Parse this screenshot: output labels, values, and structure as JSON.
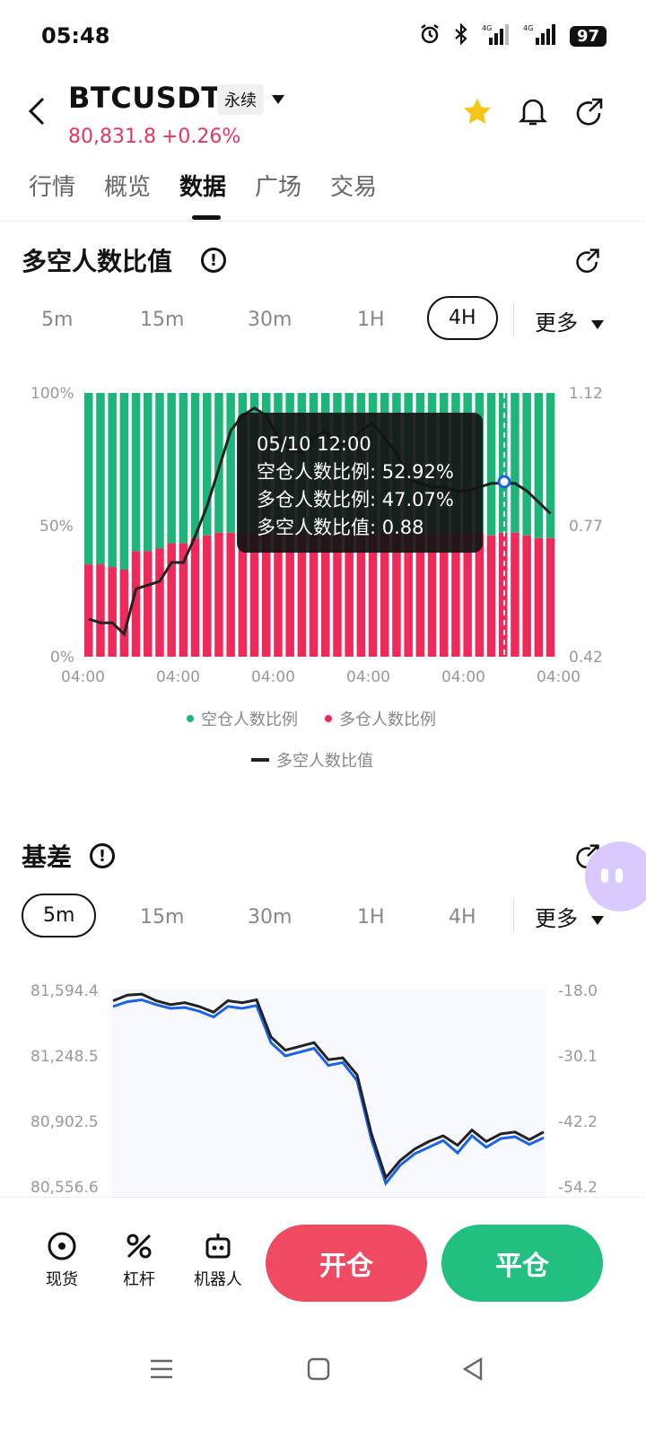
{
  "status": {
    "time": "05:48",
    "battery": "97"
  },
  "header": {
    "symbol": "BTCUSDT",
    "contract_tag": "永续",
    "price": "80,831.8",
    "change": "+0.26%"
  },
  "tabs": [
    "行情",
    "概览",
    "数据",
    "广场",
    "交易"
  ],
  "ratio_section": {
    "title": "多空人数比值",
    "timeframes": [
      "5m",
      "15m",
      "30m",
      "1H",
      "4H"
    ],
    "selected": "4H",
    "more_label": "更多",
    "tooltip": {
      "datetime": "05/10 12:00",
      "short_label": "空仓人数比例: 52.92%",
      "long_label": "多仓人数比例: 47.07%",
      "ratio_label": "多空人数比值: 0.88"
    },
    "legend": [
      "空仓人数比例",
      "多仓人数比例",
      "多空人数比值"
    ]
  },
  "basis_section": {
    "title": "基差",
    "timeframes": [
      "5m",
      "15m",
      "30m",
      "1H",
      "4H"
    ],
    "selected": "5m",
    "more_label": "更多"
  },
  "bottom": {
    "items": [
      "现货",
      "杠杆",
      "机器人"
    ],
    "open_label": "开仓",
    "close_label": "平仓"
  },
  "colors": {
    "green": "#1db57a",
    "red": "#ef2a5a",
    "accent_red": "#e7365d",
    "blue": "#1a63e6"
  },
  "chart_data": [
    {
      "type": "bar",
      "title": "多空人数比值",
      "x_ticks": [
        "04:00",
        "04:00",
        "04:00",
        "04:00",
        "04:00",
        "04:00"
      ],
      "y_left_ticks": [
        "100%",
        "50%",
        "0%"
      ],
      "y_right_ticks": [
        "1.12",
        "0.77",
        "0.42"
      ],
      "series": [
        {
          "name": "多仓人数比例",
          "values": [
            35,
            35,
            34,
            33,
            40,
            40,
            41,
            43,
            43,
            45,
            46,
            47,
            47,
            47,
            47,
            47,
            47,
            47,
            47,
            47,
            47,
            47,
            47,
            47,
            47,
            47,
            47,
            47,
            47,
            47,
            47,
            47,
            47,
            47,
            46,
            47,
            47,
            46,
            45,
            45
          ]
        },
        {
          "name": "多空人数比值",
          "values": [
            0.52,
            0.51,
            0.51,
            0.48,
            0.6,
            0.61,
            0.62,
            0.67,
            0.67,
            0.74,
            0.82,
            0.92,
            1.02,
            1.06,
            1.08,
            1.06,
            1.0,
            0.97,
            0.96,
            1.0,
            1.02,
            0.98,
            0.99,
            1.02,
            1.04,
            1.0,
            0.96,
            0.89,
            0.88,
            0.87,
            0.87,
            0.86,
            0.86,
            0.87,
            0.88,
            0.88,
            0.88,
            0.86,
            0.83,
            0.8
          ]
        }
      ],
      "ylim_left": [
        0,
        100
      ],
      "ylim_right": [
        0.42,
        1.12
      ]
    },
    {
      "type": "line",
      "title": "基差",
      "y_left_ticks": [
        "81,594.4",
        "81,248.5",
        "80,902.5",
        "80,556.6"
      ],
      "y_right_ticks": [
        "-18.0",
        "-30.1",
        "-42.2",
        "-54.2"
      ],
      "ylim": [
        80556.6,
        81594.4
      ],
      "series": [
        {
          "name": "black",
          "values": [
            81540,
            81570,
            81575,
            81540,
            81520,
            81530,
            81510,
            81480,
            81540,
            81530,
            81545,
            81350,
            81280,
            81300,
            81320,
            81230,
            81240,
            81150,
            80840,
            80610,
            80700,
            80760,
            80800,
            80830,
            80780,
            80860,
            80800,
            80840,
            80850,
            80810,
            80850
          ]
        },
        {
          "name": "blue",
          "values": [
            81510,
            81535,
            81545,
            81520,
            81500,
            81505,
            81485,
            81455,
            81510,
            81500,
            81515,
            81320,
            81250,
            81270,
            81290,
            81200,
            81215,
            81120,
            80810,
            80580,
            80675,
            80735,
            80770,
            80805,
            80740,
            80830,
            80770,
            80815,
            80825,
            80785,
            80820
          ]
        }
      ]
    }
  ]
}
